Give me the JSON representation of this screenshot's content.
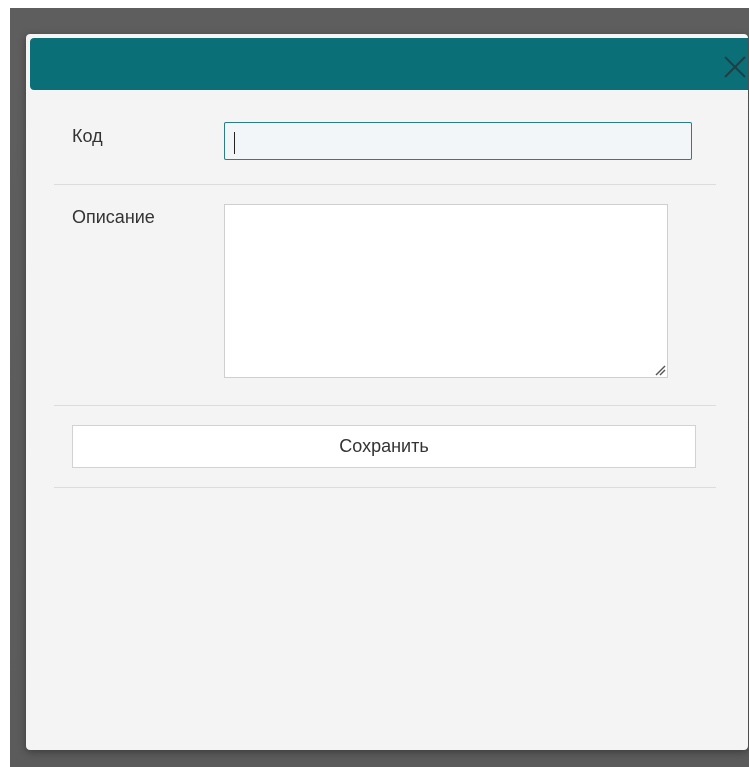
{
  "dialog": {
    "close_icon": "close-icon",
    "accent_color": "#0b6f78"
  },
  "form": {
    "code": {
      "label": "Код",
      "value": ""
    },
    "description": {
      "label": "Описание",
      "value": ""
    },
    "save_label": "Сохранить"
  }
}
